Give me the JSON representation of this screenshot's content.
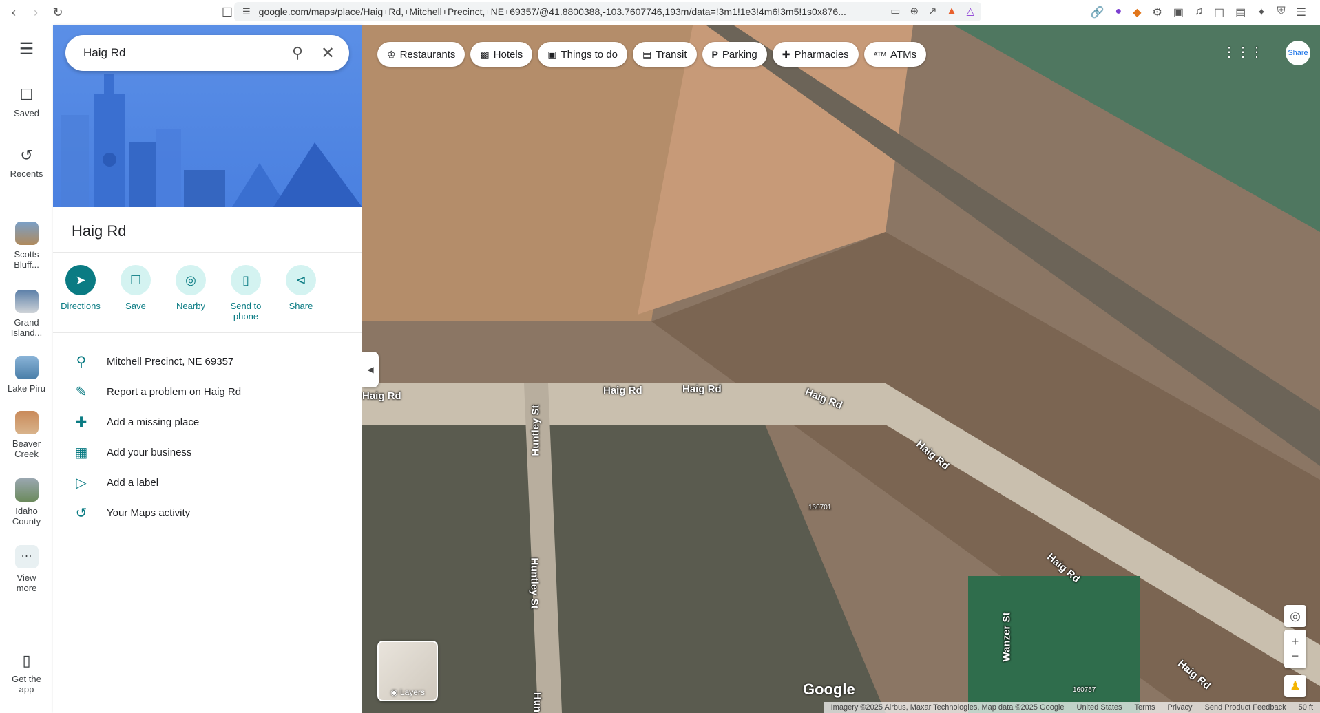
{
  "browser": {
    "url": "google.com/maps/place/Haig+Rd,+Mitchell+Precinct,+NE+69357/@41.8800388,-103.7607746,193m/data=!3m1!1e3!4m6!3m5!1s0x876..."
  },
  "rail": {
    "menu_label": "Menu",
    "items": [
      {
        "label": "Saved"
      },
      {
        "label": "Recents"
      },
      {
        "label": "Scotts Bluff..."
      },
      {
        "label": "Grand Island..."
      },
      {
        "label": "Lake Piru"
      },
      {
        "label": "Beaver Creek"
      },
      {
        "label": "Idaho County"
      },
      {
        "label": "View more"
      },
      {
        "label": "Get the app"
      }
    ]
  },
  "search": {
    "value": "Haig Rd"
  },
  "place": {
    "title": "Haig Rd",
    "actions": [
      {
        "label": "Directions"
      },
      {
        "label": "Save"
      },
      {
        "label": "Nearby"
      },
      {
        "label": "Send to phone"
      },
      {
        "label": "Share"
      }
    ],
    "info": [
      {
        "text": "Mitchell Precinct, NE 69357"
      },
      {
        "text": "Report a problem on Haig Rd"
      },
      {
        "text": "Add a missing place"
      },
      {
        "text": "Add your business"
      },
      {
        "text": "Add a label"
      },
      {
        "text": "Your Maps activity"
      }
    ]
  },
  "map": {
    "chips": [
      {
        "label": "Restaurants"
      },
      {
        "label": "Hotels"
      },
      {
        "label": "Things to do"
      },
      {
        "label": "Transit"
      },
      {
        "label": "Parking"
      },
      {
        "label": "Pharmacies"
      },
      {
        "label": "ATMs"
      }
    ],
    "road_labels": [
      "Haig Rd",
      "Haig Rd",
      "Haig Rd",
      "Haig Rd",
      "Haig Rd",
      "Haig Rd",
      "Haig Rd",
      "Huntley St",
      "Huntley St",
      "Wanzer St",
      "Hun"
    ],
    "address_numbers": [
      "160701",
      "160757"
    ],
    "layers_label": "Layers",
    "logo": "Google",
    "attribution": {
      "imagery": "Imagery ©2025 Airbus, Maxar Technologies, Map data ©2025 Google",
      "country": "United States",
      "terms": "Terms",
      "privacy": "Privacy",
      "feedback": "Send Product Feedback",
      "scale": "50 ft"
    },
    "share_label": "Share"
  }
}
